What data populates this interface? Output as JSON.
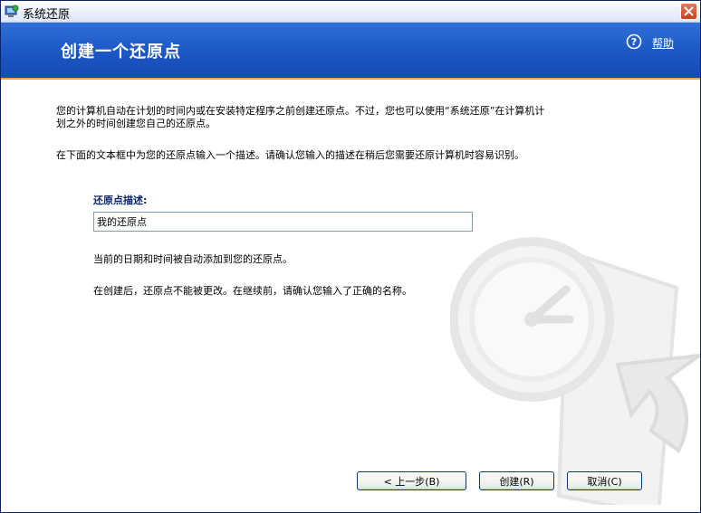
{
  "window": {
    "title": "系统还原",
    "close_label": "关闭"
  },
  "banner": {
    "title": "创建一个还原点",
    "help": "帮助"
  },
  "content": {
    "intro": "您的计算机自动在计划的时间内或在安装特定程序之前创建还原点。不过，您也可以使用“系统还原”在计算机计划之外的时间创建您自己的还原点。",
    "instruction": "在下面的文本框中为您的还原点输入一个描述。请确认您输入的描述在稍后您需要还原计算机时容易识别。",
    "field_label": "还原点描述:",
    "field_value": "我的还原点",
    "note_datetime": "当前的日期和时间被自动添加到您的还原点。",
    "note_warning": "在创建后，还原点不能被更改。在继续前，请确认您输入了正确的名称。"
  },
  "buttons": {
    "back": "< 上一步(B)",
    "create": "创建(R)",
    "cancel": "取消(C)"
  },
  "colors": {
    "banner": "#1b56c4",
    "accent_line": "#f1a23a",
    "label": "#0a246a"
  },
  "icons": {
    "app": "system-restore-icon",
    "help": "help-question-icon",
    "watermark": "restore-clock-watermark-icon"
  }
}
